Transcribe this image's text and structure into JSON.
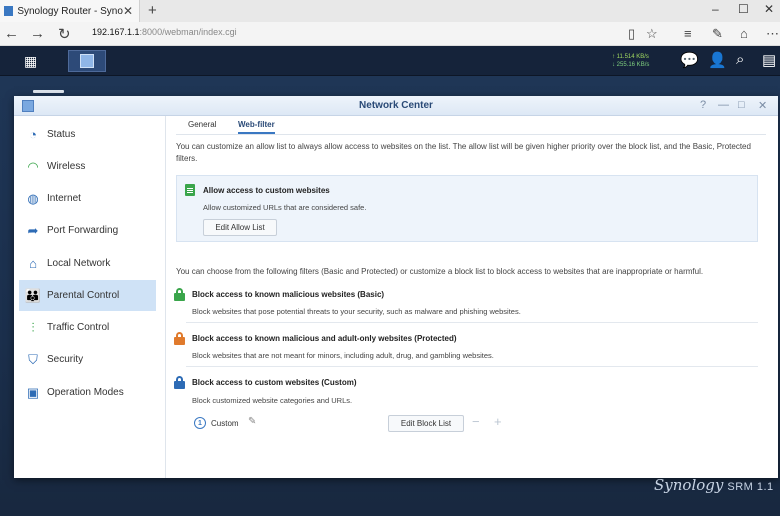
{
  "browser": {
    "tab_title": "Synology Router - Syno",
    "tab_close": "✕",
    "new_tab": "+",
    "url_host": "192.167.1.1",
    "url_path": ":8000/webman/index.cgi",
    "win_minimize": "–",
    "win_maximize": "☐",
    "win_close": "✕"
  },
  "taskbar": {
    "speed_up": "↑ 11.514 KB/s",
    "speed_down": "↓ 255.16 KB/s"
  },
  "window": {
    "title": "Network Center",
    "help": "?",
    "minimize": "—",
    "maximize": "□",
    "close": "✕"
  },
  "sidebar": {
    "items": [
      {
        "label": "Status"
      },
      {
        "label": "Wireless"
      },
      {
        "label": "Internet"
      },
      {
        "label": "Port Forwarding"
      },
      {
        "label": "Local Network"
      },
      {
        "label": "Parental Control"
      },
      {
        "label": "Traffic Control"
      },
      {
        "label": "Security"
      },
      {
        "label": "Operation Modes"
      }
    ],
    "active_index": 5
  },
  "tabs": [
    {
      "label": "General"
    },
    {
      "label": "Web-filter"
    }
  ],
  "allow": {
    "intro": "You can customize an allow list to always allow access to websites on the list. The allow list will be given higher priority over the block list, and the Basic, Protected filters.",
    "title": "Allow access to custom websites",
    "desc": "Allow customized URLs that are considered safe.",
    "button": "Edit Allow List"
  },
  "filters": {
    "intro": "You can choose from the following filters (Basic and Protected) or customize a block list to block access to websites that are inappropriate or harmful.",
    "basic": {
      "title": "Block access to known malicious websites (Basic)",
      "desc": "Block websites that pose potential threats to your security, such as malware and phishing websites.",
      "color": "#3aa54b"
    },
    "protected": {
      "title": "Block access to known malicious and adult-only websites (Protected)",
      "desc": "Block websites that are not meant for minors, including adult, drug, and gambling websites.",
      "color": "#e07a2c"
    },
    "custom": {
      "title": "Block access to custom websites (Custom)",
      "desc": "Block customized website categories and URLs.",
      "color": "#2d6bb5",
      "badge": "1",
      "profile": "Custom",
      "button": "Edit Block List",
      "minus": "−",
      "plus": "+"
    }
  },
  "brand": {
    "name": "Synology",
    "product": "SRM 1.1"
  }
}
